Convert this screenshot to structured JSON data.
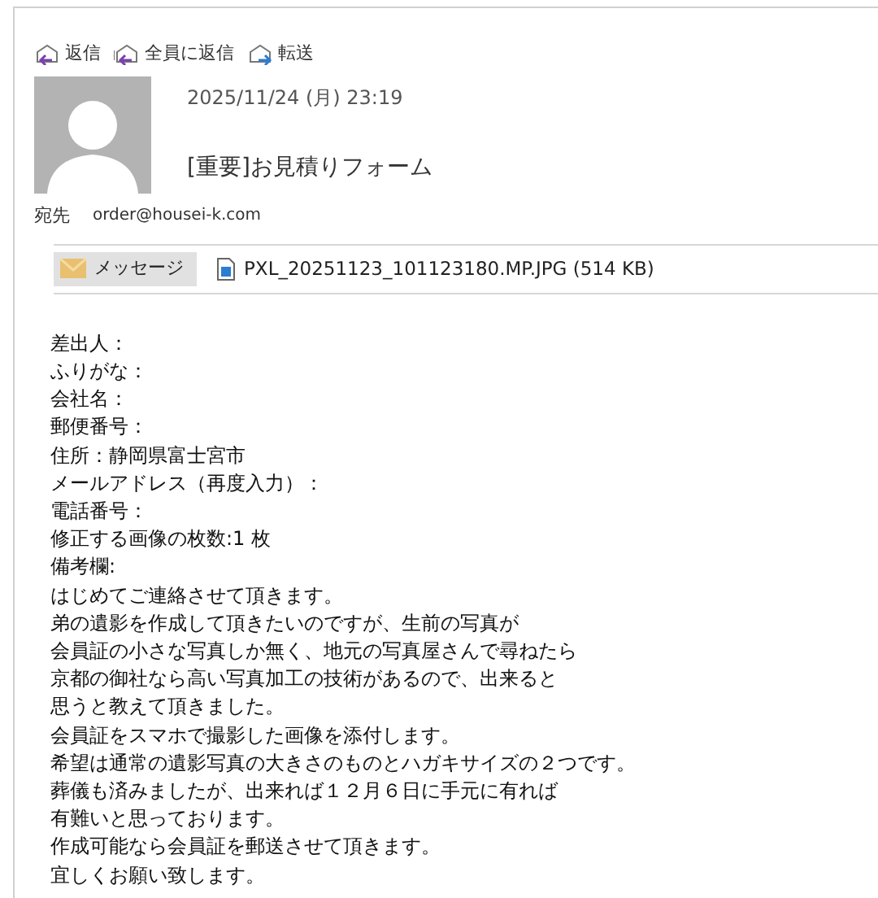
{
  "actions": [
    {
      "label": "返信",
      "kind": "reply"
    },
    {
      "label": "全員に返信",
      "kind": "reply-all"
    },
    {
      "label": "転送",
      "kind": "forward"
    }
  ],
  "date": "2025/11/24 (月) 23:19",
  "subject": "[重要]お見積りフォーム",
  "to": {
    "label": "宛先",
    "address": "order@housei-k.com"
  },
  "tabs": [
    {
      "label": "メッセージ",
      "kind": "message",
      "selected": true
    },
    {
      "label": "PXL_20251123_101123180.MP.JPG (514 KB)",
      "kind": "attachment",
      "selected": false
    }
  ],
  "body": [
    "差出人：",
    "ふりがな：",
    "会社名：",
    "郵便番号：",
    "住所：静岡県富士宮市",
    "メールアドレス（再度入力）：",
    "電話番号：",
    "修正する画像の枚数:1 枚",
    "備考欄:",
    "はじめてご連絡させて頂きます。",
    "弟の遺影を作成して頂きたいのですが、生前の写真が",
    "会員証の小さな写真しか無く、地元の写真屋さんで尋ねたら",
    "京都の御社なら高い写真加工の技術があるので、出来ると",
    "思うと教えて頂きました。",
    "会員証をスマホで撮影した画像を添付します。",
    "希望は通常の遺影写真の大きさのものとハガキサイズの２つです。",
    "葬儀も済みましたが、出来れば１２月６日に手元に有れば",
    "有難いと思っております。",
    "作成可能なら会員証を郵送させて頂きます。",
    "宜しくお願い致します。"
  ]
}
